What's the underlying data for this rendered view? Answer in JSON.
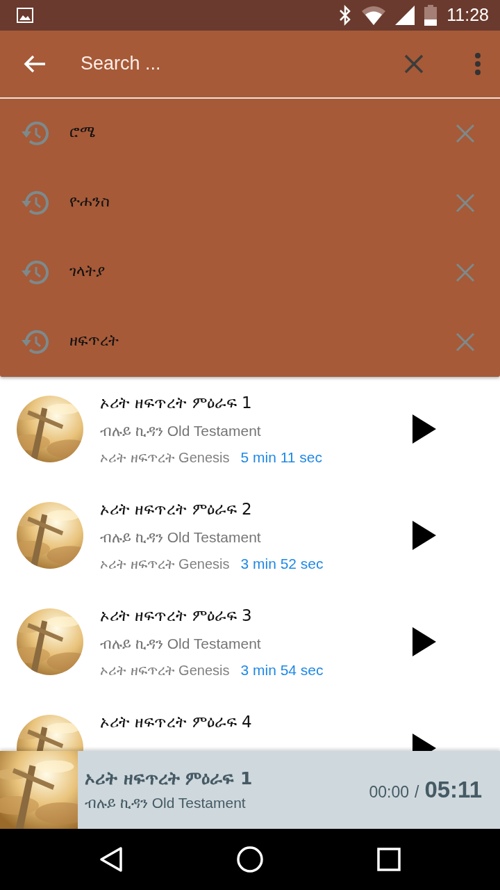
{
  "status_bar": {
    "time": "11:28"
  },
  "search": {
    "placeholder": "Search ..."
  },
  "suggestions": [
    {
      "text": "ሮሜ"
    },
    {
      "text": "ዮሐንስ"
    },
    {
      "text": "ገላትያ"
    },
    {
      "text": "ዘፍጥረት"
    }
  ],
  "tracks": [
    {
      "title": "ኦሪት ዘፍጥረት ምዕራፍ 1",
      "subtitle": "ብሉይ ኪዳን Old Testament",
      "book": "ኦሪት ዘፍጥረት Genesis",
      "duration": "5 min 11 sec"
    },
    {
      "title": "ኦሪት ዘፍጥረት ምዕራፍ 2",
      "subtitle": "ብሉይ ኪዳን Old Testament",
      "book": "ኦሪት ዘፍጥረት Genesis",
      "duration": "3 min 52 sec"
    },
    {
      "title": "ኦሪት ዘፍጥረት ምዕራፍ 3",
      "subtitle": "ብሉይ ኪዳን Old Testament",
      "book": "ኦሪት ዘፍጥረት Genesis",
      "duration": "3 min 54 sec"
    },
    {
      "title": "ኦሪት ዘፍጥረት ምዕራፍ 4"
    }
  ],
  "player": {
    "title": "ኦሪት ዘፍጥረት ምዕራፍ 1",
    "subtitle": "ብሉይ ኪዳን Old Testament",
    "elapsed": "00:00",
    "separator": "/",
    "total": "05:11"
  }
}
